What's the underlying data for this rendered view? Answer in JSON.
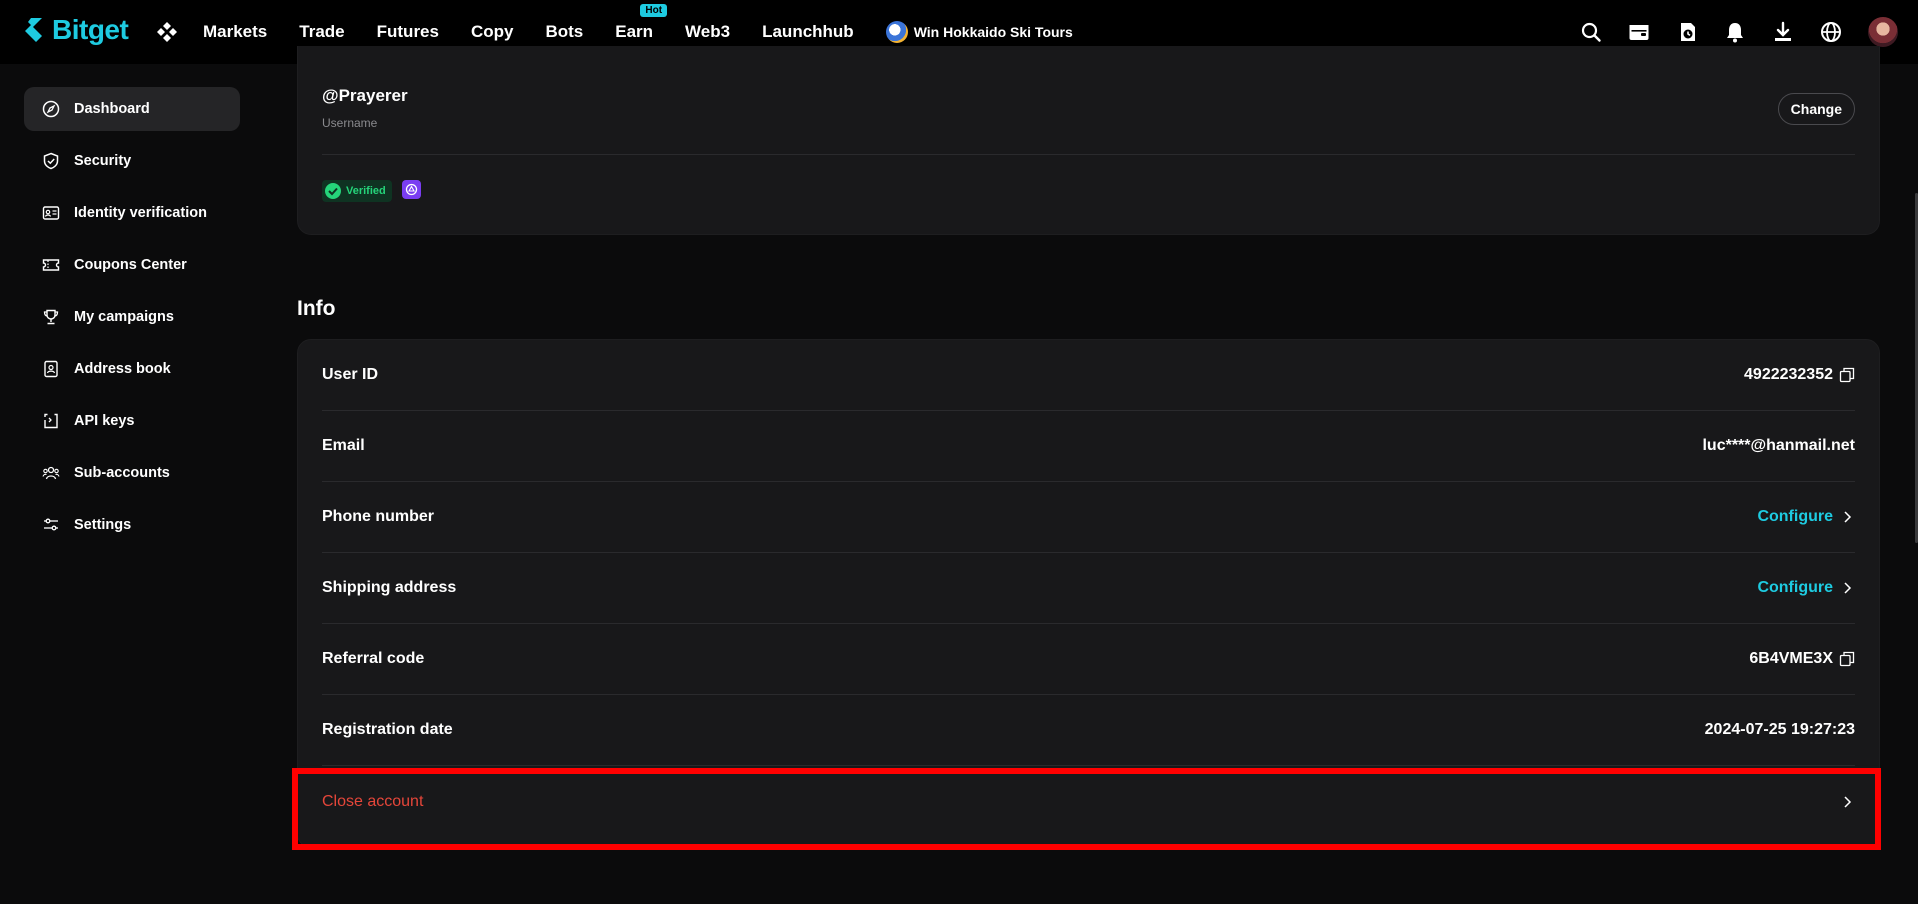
{
  "brand": {
    "name": "Bitget",
    "accent": "#1ecbe1"
  },
  "nav": {
    "items": [
      "Markets",
      "Trade",
      "Futures",
      "Copy",
      "Bots",
      "Earn",
      "Web3",
      "Launchhub"
    ],
    "hot_badge": "Hot",
    "promo": "Win Hokkaido Ski Tours",
    "right_icons": [
      "search-icon",
      "wallet-icon",
      "orders-icon",
      "bell-icon",
      "download-icon",
      "globe-icon",
      "avatar"
    ]
  },
  "sidebar": {
    "items": [
      {
        "label": "Dashboard",
        "icon": "compass-icon",
        "active": true
      },
      {
        "label": "Security",
        "icon": "shield-icon",
        "active": false
      },
      {
        "label": "Identity verification",
        "icon": "id-card-icon",
        "active": false
      },
      {
        "label": "Coupons Center",
        "icon": "ticket-icon",
        "active": false
      },
      {
        "label": "My campaigns",
        "icon": "trophy-icon",
        "active": false
      },
      {
        "label": "Address book",
        "icon": "contact-book-icon",
        "active": false
      },
      {
        "label": "API keys",
        "icon": "api-icon",
        "active": false
      },
      {
        "label": "Sub-accounts",
        "icon": "users-icon",
        "active": false
      },
      {
        "label": "Settings",
        "icon": "sliders-icon",
        "active": false
      }
    ]
  },
  "profile": {
    "username": "@Prayerer",
    "username_label": "Username",
    "change_label": "Change",
    "verified_label": "Verified"
  },
  "info": {
    "title": "Info",
    "rows": [
      {
        "label": "User ID",
        "value": "4922232352",
        "action": "copy"
      },
      {
        "label": "Email",
        "value": "luc****@hanmail.net"
      },
      {
        "label": "Phone number",
        "value": "Configure",
        "action": "link"
      },
      {
        "label": "Shipping address",
        "value": "Configure",
        "action": "link"
      },
      {
        "label": "Referral code",
        "value": "6B4VME3X",
        "action": "copy"
      },
      {
        "label": "Registration date",
        "value": "2024-07-25 19:27:23"
      }
    ],
    "close_account": "Close account"
  },
  "colors": {
    "link": "#1ecbe1",
    "danger": "#e5463a",
    "verified": "#25d47a",
    "highlight": "#ff0000"
  }
}
